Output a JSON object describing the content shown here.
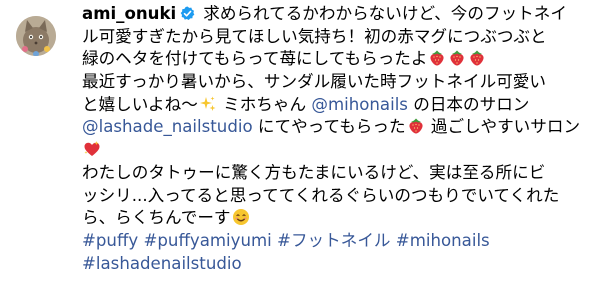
{
  "post": {
    "username": "ami_onuki",
    "verified_icon": "verified-badge-icon",
    "avatar_icon": "avatar-cat-icon",
    "caption_lines": [
      {
        "parts": [
          {
            "type": "text",
            "text": "求められてるかわからないけど、今のフットネイ"
          }
        ]
      },
      {
        "parts": [
          {
            "type": "text",
            "text": "ル可愛すぎたから見てほしい気持ち！初の赤マグにつぶつぶと"
          }
        ]
      },
      {
        "parts": [
          {
            "type": "text",
            "text": "緑のヘタを付けてもらって苺にしてもらったよ"
          },
          {
            "type": "emoji",
            "icon": "strawberry-icon"
          },
          {
            "type": "emoji",
            "icon": "strawberry-icon"
          },
          {
            "type": "emoji",
            "icon": "strawberry-icon"
          }
        ]
      },
      {
        "parts": [
          {
            "type": "text",
            "text": "最近すっかり暑いから、サンダル履いた時フットネイル可愛い"
          }
        ]
      },
      {
        "parts": [
          {
            "type": "text",
            "text": "と嬉しいよね〜"
          },
          {
            "type": "emoji",
            "icon": "sparkles-icon"
          },
          {
            "type": "text",
            "text": " ミホちゃん "
          },
          {
            "type": "mention",
            "text": "@mihonails"
          },
          {
            "type": "text",
            "text": " の日本のサロン"
          }
        ]
      },
      {
        "parts": [
          {
            "type": "mention",
            "text": "@lashade_nailstudio"
          },
          {
            "type": "text",
            "text": " にてやってもらった"
          },
          {
            "type": "emoji",
            "icon": "strawberry-icon"
          },
          {
            "type": "text",
            "text": " 過ごしやすいサロン"
          }
        ]
      },
      {
        "parts": [
          {
            "type": "emoji",
            "icon": "sparkling-heart-icon"
          }
        ]
      },
      {
        "parts": [
          {
            "type": "text",
            "text": "わたしのタトゥーに驚く方もたまにいるけど、実は至る所にビ"
          }
        ]
      },
      {
        "parts": [
          {
            "type": "text",
            "text": "ッシリ...入ってると思っててくれるぐらいのつもりでいてくれた"
          }
        ]
      },
      {
        "parts": [
          {
            "type": "text",
            "text": "ら、らくちんでーす"
          },
          {
            "type": "emoji",
            "icon": "smiling-face-icon"
          }
        ]
      },
      {
        "parts": [
          {
            "type": "tag",
            "text": "#puffy"
          },
          {
            "type": "text",
            "text": " "
          },
          {
            "type": "tag",
            "text": "#puffyamiyumi"
          },
          {
            "type": "text",
            "text": " "
          },
          {
            "type": "tag",
            "text": "#フットネイル"
          },
          {
            "type": "text",
            "text": " "
          },
          {
            "type": "tag",
            "text": "#mihonails"
          }
        ]
      },
      {
        "parts": [
          {
            "type": "tag",
            "text": "#lashadenailstudio"
          }
        ]
      }
    ]
  },
  "colors": {
    "link": "#385898",
    "verified": "#1d9bf0",
    "strawberry": "#e0313a"
  }
}
